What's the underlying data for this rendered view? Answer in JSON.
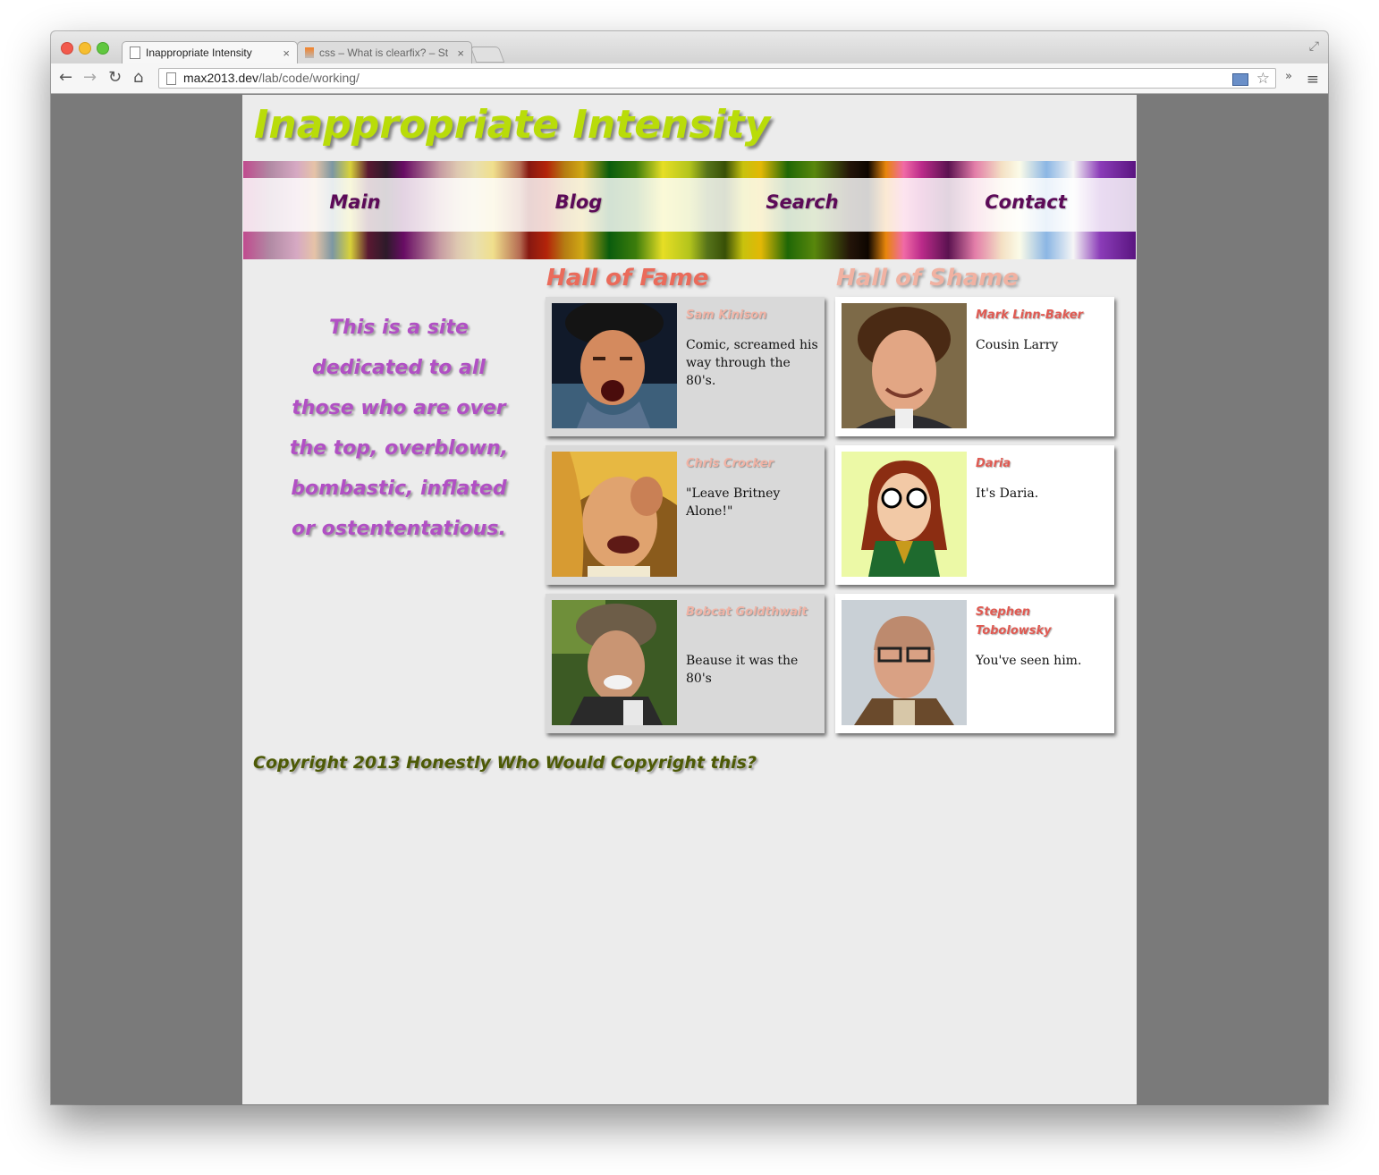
{
  "browser": {
    "tabs": [
      {
        "title": "Inappropriate Intensity",
        "close": "×"
      },
      {
        "title": "css – What is clearfix? – St",
        "close": "×"
      }
    ],
    "url_host": "max2013.dev",
    "url_path": "/lab/code/working/",
    "icons": [
      "back-arrow-icon",
      "forward-arrow-icon",
      "reload-icon",
      "home-icon",
      "page-icon",
      "star-icon",
      "menu-icon"
    ]
  },
  "site": {
    "title": "Inappropriate Intensity",
    "nav": [
      "Main",
      "Blog",
      "Search",
      "Contact"
    ],
    "tagline": "This is a site dedicated to all those who are over the top, overblown, bombastic, inflated or ostententatious.",
    "fame_title": "Hall of Fame",
    "shame_title": "Hall of Shame",
    "fame": [
      {
        "name": "Sam Kinison",
        "desc": "Comic, screamed his way through the 80's."
      },
      {
        "name": "Chris Crocker",
        "desc": "\"Leave Britney Alone!\""
      },
      {
        "name": "Bobcat Goldthwait",
        "desc": "Beause it was the 80's"
      }
    ],
    "shame": [
      {
        "name": "Mark Linn-Baker",
        "desc": "Cousin Larry"
      },
      {
        "name": "Daria",
        "desc": "It's Daria."
      },
      {
        "name": "Stephen Tobolowsky",
        "desc": "You've seen him."
      }
    ],
    "footer": "Copyright 2013 Honestly Who Would Copyright this?"
  }
}
